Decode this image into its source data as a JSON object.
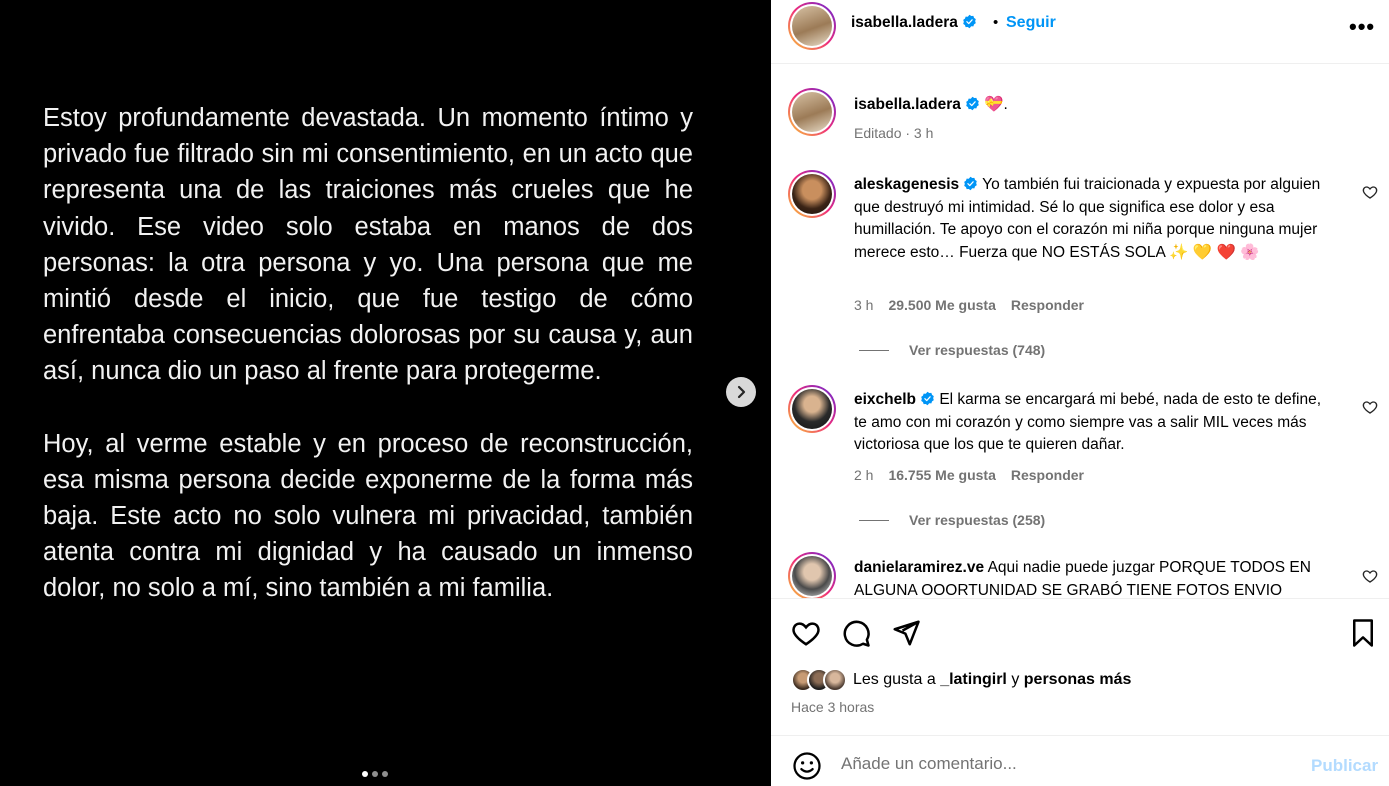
{
  "media": {
    "paragraphs": [
      "Estoy profundamente devastada. Un momento íntimo y privado fue filtrado sin mi consentimiento, en un acto que representa una de las traiciones más crueles que he vivido. Ese video solo estaba en manos de dos personas: la otra persona y yo. Una persona que me mintió desde el inicio, que fue testigo de cómo enfrentaba consecuencias dolorosas por su causa y, aun así, nunca dio un paso al frente para protegerme.",
      "Hoy, al verme estable y en proceso de reconstrucción, esa misma persona decide exponerme de la forma más baja. Este acto no solo vulnera mi privacidad, también atenta contra mi dignidad y ha causado un inmenso dolor, no solo a mí, sino también a mi familia."
    ],
    "carousel_index": 1,
    "carousel_total": 3
  },
  "header": {
    "username": "isabella.ladera",
    "separator": "•",
    "follow_label": "Seguir",
    "more_label": "•••"
  },
  "caption": {
    "username": "isabella.ladera",
    "text": "💝.",
    "meta": "Editado · 3 h"
  },
  "comments": [
    {
      "username": "aleskagenesis",
      "text": "Yo también fui traicionada y expuesta por alguien que destruyó mi intimidad. Sé lo que significa ese dolor y esa humillación. Te apoyo con el corazón mi niña porque ninguna mujer merece esto… Fuerza que NO ESTÁS SOLA ✨ 💛 ❤️ 🌸",
      "time": "3 h",
      "likes": "29.500 Me gusta",
      "reply_label": "Responder",
      "view_replies": "Ver respuestas (748)"
    },
    {
      "username": "eixchelb",
      "text": "El karma se encargará mi bebé, nada de esto te define, te amo con mi corazón y como siempre vas a salir MIL veces más victoriosa que los que te quieren dañar.",
      "time": "2 h",
      "likes": "16.755 Me gusta",
      "reply_label": "Responder",
      "view_replies": "Ver respuestas (258)"
    },
    {
      "username": "danielaramirez.ve",
      "text": "Aqui nadie puede juzgar PORQUE TODOS EN ALGUNA OOORTUNIDAD SE GRABÓ TIENE FOTOS ENVIO"
    }
  ],
  "likes": {
    "prefix": "Les gusta a",
    "user": "_latingirl",
    "conj": "y",
    "rest": "personas más"
  },
  "time_ago": "Hace 3 horas",
  "add_comment": {
    "placeholder": "Añade un comentario...",
    "publish_label": "Publicar"
  },
  "colors": {
    "link_blue": "#0095f6",
    "verified_blue": "#0095f6",
    "publish_disabled": "#b3dbff",
    "secondary_text": "#737373"
  }
}
